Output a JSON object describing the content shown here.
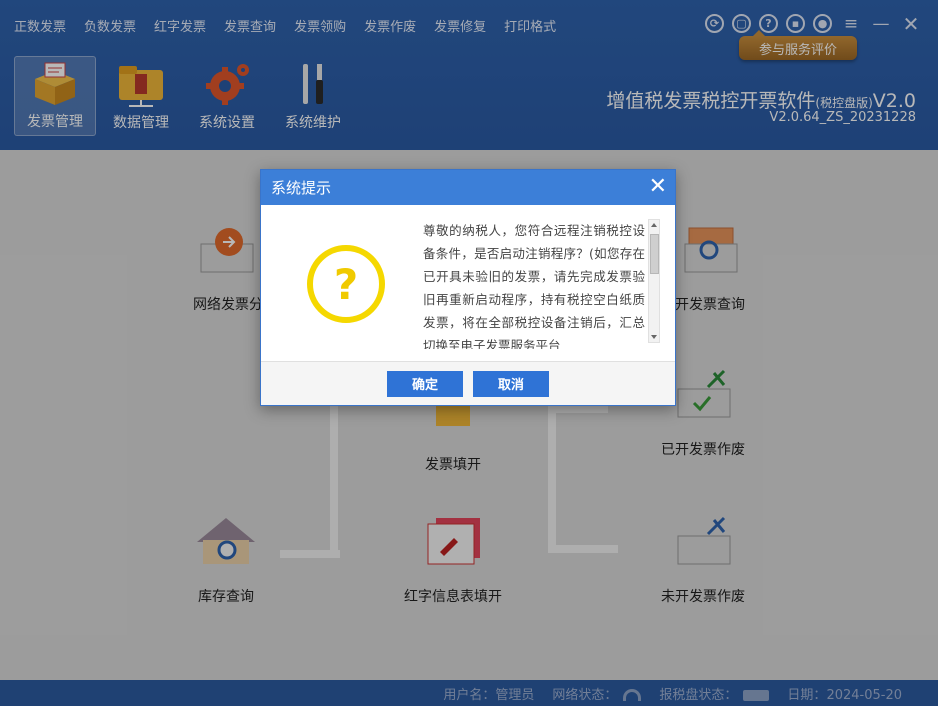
{
  "menu": [
    "正数发票",
    "负数发票",
    "红字发票",
    "发票查询",
    "发票领购",
    "发票作废",
    "发票修复",
    "打印格式"
  ],
  "rate_button": "参与服务评价",
  "toolbar": [
    {
      "label": "发票管理",
      "icon": "invoice-box-icon",
      "active": true
    },
    {
      "label": "数据管理",
      "icon": "data-folder-icon",
      "active": false
    },
    {
      "label": "系统设置",
      "icon": "gear-icon",
      "active": false
    },
    {
      "label": "系统维护",
      "icon": "tools-icon",
      "active": false
    }
  ],
  "app": {
    "title": "增值税发票税控开票软件",
    "title_suffix": "(税控盘版)",
    "title_version": "V2.0",
    "version": "V2.0.64_ZS_20231228"
  },
  "features": {
    "network": "网络发票分",
    "query": "开发票查询",
    "fill": "发票填开",
    "void_issued": "已开发票作废",
    "stock": "库存查询",
    "red_info": "红字信息表填开",
    "void_blank": "未开发票作废"
  },
  "dialog": {
    "title": "系统提示",
    "message": "尊敬的纳税人，您符合远程注销税控设备条件，是否启动注销程序？(如您存在已开具未验旧的发票，请先完成发票验旧再重新启动程序，持有税控空白纸质发票，将在全部税控设备注销后，汇总切换至电子发票服务平台",
    "ok": "确定",
    "cancel": "取消"
  },
  "status": {
    "user_label": "用户名：",
    "user": "管理员",
    "network_label": "网络状态：",
    "disk_label": "报税盘状态：",
    "date_label": "日期：",
    "date": "2024-05-20"
  },
  "colors": {
    "header": "#2f63ad",
    "dialog_header": "#3c7fd8",
    "button": "#2f73d6",
    "question": "#f5d800"
  }
}
